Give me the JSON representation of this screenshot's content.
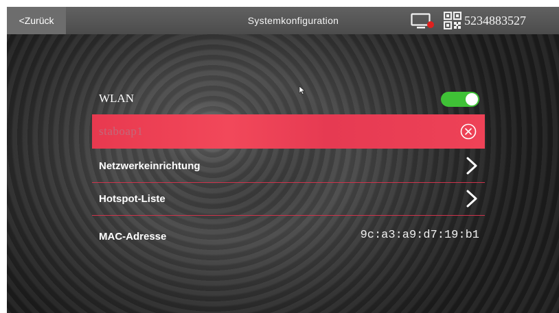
{
  "header": {
    "back_label": "<Zurück",
    "title": "Systemkonfiguration",
    "device_id": "5234883527",
    "monitor_icon": "monitor-alert-icon",
    "qr_icon": "qr-code-icon",
    "alert_color": "#e0201e"
  },
  "wlan": {
    "label": "WLAN",
    "enabled": true,
    "toggle_color": "#3fc236"
  },
  "network": {
    "ssid": "staboap1",
    "clear_icon": "clear-circle-icon",
    "highlight_color": "#ee4257"
  },
  "menu": {
    "items": [
      {
        "label": "Netzwerkeinrichtung",
        "icon": "chevron-right-icon"
      },
      {
        "label": "Hotspot-Liste",
        "icon": "chevron-right-icon"
      }
    ]
  },
  "mac": {
    "label": "MAC-Adresse",
    "value": "9c:a3:a9:d7:19:b1"
  }
}
